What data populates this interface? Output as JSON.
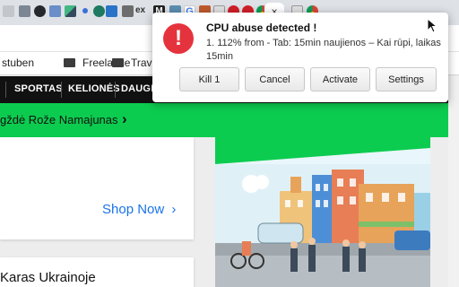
{
  "notification": {
    "title": "CPU abuse detected !",
    "message": "1. 112% from - Tab: 15min naujienos – Kai rūpi, laikas 15min",
    "icon": "exclamation-icon",
    "icon_glyph": "!",
    "buttons": [
      "Kill 1",
      "Cancel",
      "Activate",
      "Settings"
    ]
  },
  "tabs": {
    "favicons": [
      "generic-favicon",
      "tile-favicon",
      "github-favicon",
      "translate-favicon",
      "vue-favicon",
      "dot-favicon",
      "tab-favicon",
      "b-favicon",
      "chart-favicon",
      "ex-favicon",
      "m-favicon",
      "photo-favicon",
      "g-favicon",
      "bookmark-favicon",
      "flag-favicon",
      "opera-favicon",
      "opera-favicon",
      "chrome-favicon",
      "flag-favicon",
      "chrome-favicon"
    ],
    "favicon_labels": [
      "ex",
      "M",
      "G"
    ],
    "close_glyph": "×",
    "new_tab_glyph": "×"
  },
  "bookmarks": [
    {
      "label": "stuben",
      "folder": false
    },
    {
      "label": "Freelance",
      "folder": true
    },
    {
      "label": "Trave",
      "folder": true
    }
  ],
  "site_nav": {
    "items": [
      "SPORTAS",
      "KELIONĖS",
      "DAUGIA"
    ]
  },
  "banner": {
    "text": "gždė Rože Namajunas",
    "chevron": "›"
  },
  "cards": {
    "shop_now": "Shop Now",
    "shop_chevron": "›",
    "article_title": "Karas Ukrainoje"
  },
  "colors": {
    "accent_green": "#0ccc4f",
    "alert_red": "#e5333d",
    "link_blue": "#1a73e8"
  }
}
